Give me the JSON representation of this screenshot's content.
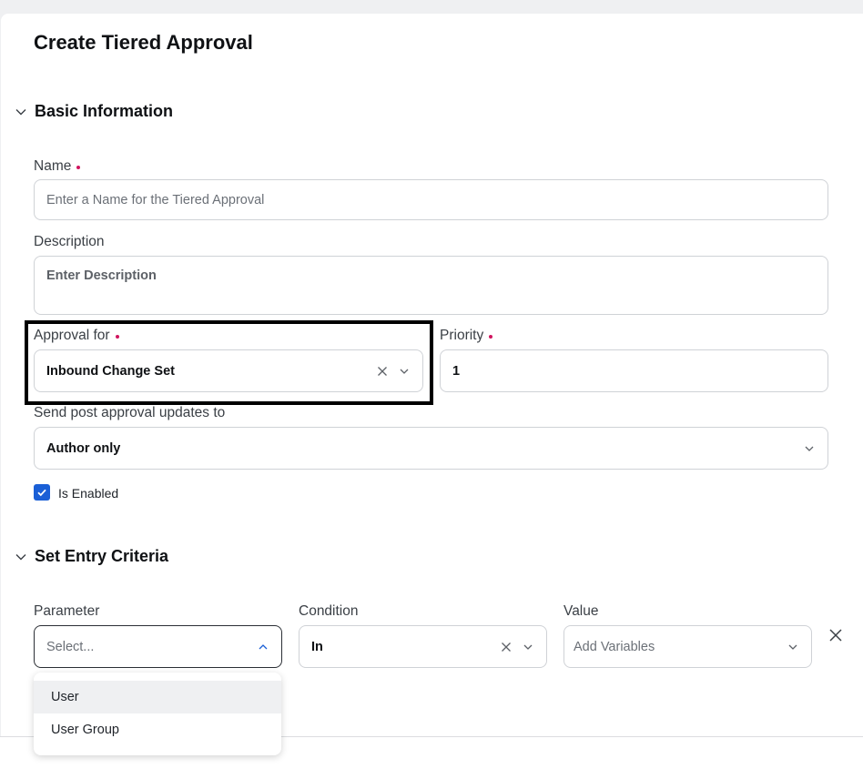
{
  "page": {
    "title": "Create Tiered Approval"
  },
  "sections": {
    "basic": {
      "title": "Basic Information"
    },
    "entry": {
      "title": "Set Entry Criteria"
    }
  },
  "form": {
    "name": {
      "label": "Name",
      "placeholder": "Enter a Name for the Tiered Approval"
    },
    "description": {
      "label": "Description",
      "placeholder": "Enter Description"
    },
    "approval_for": {
      "label": "Approval for",
      "value": "Inbound Change Set"
    },
    "priority": {
      "label": "Priority",
      "value": "1"
    },
    "post_updates": {
      "label": "Send post approval updates to",
      "value": "Author only"
    },
    "is_enabled": {
      "label": "Is Enabled",
      "checked": true
    }
  },
  "criteria": {
    "parameter": {
      "label": "Parameter",
      "placeholder": "Select...",
      "options": [
        "User",
        "User Group"
      ],
      "hovered": "User"
    },
    "condition": {
      "label": "Condition",
      "value": "In"
    },
    "value": {
      "label": "Value",
      "placeholder": "Add Variables"
    }
  },
  "colors": {
    "accent": "#1a5fd6",
    "required": "#d0155e",
    "border": "#cfd2d6"
  },
  "icons": [
    "chevron-down-icon",
    "chevron-up-icon",
    "clear-x-icon",
    "check-icon",
    "close-icon"
  ]
}
